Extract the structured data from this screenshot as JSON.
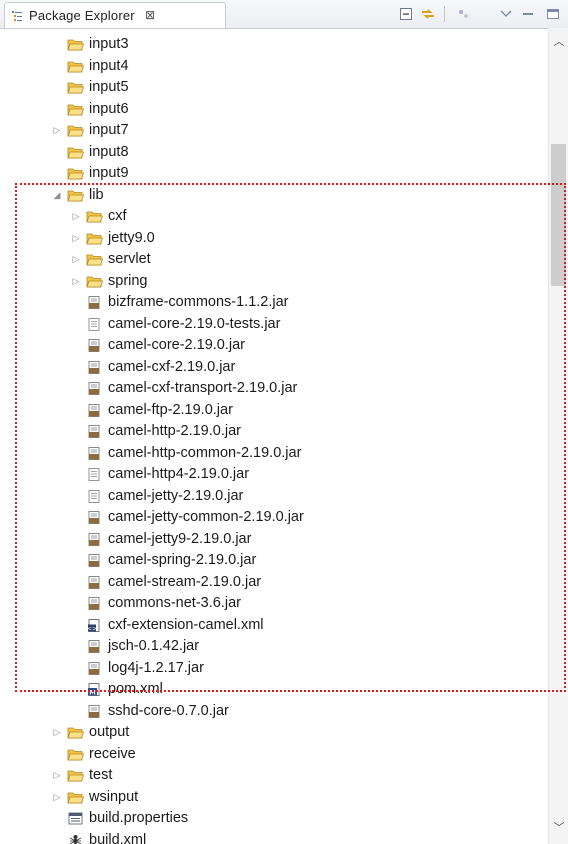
{
  "view": {
    "title": "Package Explorer",
    "close_glyph": "⊠"
  },
  "toolbar": [
    {
      "icon": "collapse-all-icon"
    },
    {
      "icon": "link-with-editor-icon"
    },
    {
      "icon": "filters-icon"
    },
    {
      "icon": "view-menu-icon"
    },
    {
      "icon": "minimize-icon"
    },
    {
      "icon": "maximize-icon"
    }
  ],
  "tree": {
    "items": [
      {
        "label": "input3",
        "icon": "folder-icon",
        "twisty": ""
      },
      {
        "label": "input4",
        "icon": "folder-icon",
        "twisty": ""
      },
      {
        "label": "input5",
        "icon": "folder-icon",
        "twisty": ""
      },
      {
        "label": "input6",
        "icon": "folder-icon",
        "twisty": ""
      },
      {
        "label": "input7",
        "icon": "folder-icon",
        "twisty": "collapsed"
      },
      {
        "label": "input8",
        "icon": "folder-icon",
        "twisty": ""
      },
      {
        "label": "input9",
        "icon": "folder-icon",
        "twisty": ""
      },
      {
        "label": "lib",
        "icon": "folder-icon",
        "twisty": "expanded"
      },
      {
        "label": "cxf",
        "icon": "folder-icon",
        "twisty": "collapsed"
      },
      {
        "label": "jetty9.0",
        "icon": "folder-icon",
        "twisty": "collapsed"
      },
      {
        "label": "servlet",
        "icon": "folder-icon",
        "twisty": "collapsed"
      },
      {
        "label": "spring",
        "icon": "folder-icon",
        "twisty": "collapsed"
      },
      {
        "label": "bizframe-commons-1.1.2.jar",
        "icon": "jar-icon",
        "twisty": ""
      },
      {
        "label": "camel-core-2.19.0-tests.jar",
        "icon": "file-icon",
        "twisty": ""
      },
      {
        "label": "camel-core-2.19.0.jar",
        "icon": "jar-icon",
        "twisty": ""
      },
      {
        "label": "camel-cxf-2.19.0.jar",
        "icon": "jar-icon",
        "twisty": ""
      },
      {
        "label": "camel-cxf-transport-2.19.0.jar",
        "icon": "jar-icon",
        "twisty": ""
      },
      {
        "label": "camel-ftp-2.19.0.jar",
        "icon": "jar-icon",
        "twisty": ""
      },
      {
        "label": "camel-http-2.19.0.jar",
        "icon": "jar-icon",
        "twisty": ""
      },
      {
        "label": "camel-http-common-2.19.0.jar",
        "icon": "jar-icon",
        "twisty": ""
      },
      {
        "label": "camel-http4-2.19.0.jar",
        "icon": "file-icon",
        "twisty": ""
      },
      {
        "label": "camel-jetty-2.19.0.jar",
        "icon": "file-icon",
        "twisty": ""
      },
      {
        "label": "camel-jetty-common-2.19.0.jar",
        "icon": "jar-icon",
        "twisty": ""
      },
      {
        "label": "camel-jetty9-2.19.0.jar",
        "icon": "jar-icon",
        "twisty": ""
      },
      {
        "label": "camel-spring-2.19.0.jar",
        "icon": "jar-icon",
        "twisty": ""
      },
      {
        "label": "camel-stream-2.19.0.jar",
        "icon": "jar-icon",
        "twisty": ""
      },
      {
        "label": "commons-net-3.6.jar",
        "icon": "jar-icon",
        "twisty": ""
      },
      {
        "label": "cxf-extension-camel.xml",
        "icon": "xml-icon",
        "twisty": ""
      },
      {
        "label": "jsch-0.1.42.jar",
        "icon": "jar-icon",
        "twisty": ""
      },
      {
        "label": "log4j-1.2.17.jar",
        "icon": "jar-icon",
        "twisty": ""
      },
      {
        "label": "pom.xml",
        "icon": "maven-pom-icon",
        "twisty": ""
      },
      {
        "label": "sshd-core-0.7.0.jar",
        "icon": "jar-icon",
        "twisty": ""
      },
      {
        "label": "output",
        "icon": "folder-icon",
        "twisty": "collapsed"
      },
      {
        "label": "receive",
        "icon": "folder-icon",
        "twisty": ""
      },
      {
        "label": "test",
        "icon": "folder-icon",
        "twisty": "collapsed"
      },
      {
        "label": "wsinput",
        "icon": "folder-icon",
        "twisty": "collapsed"
      },
      {
        "label": "build.properties",
        "icon": "properties-icon",
        "twisty": ""
      },
      {
        "label": "build.xml",
        "icon": "ant-build-icon",
        "twisty": ""
      }
    ]
  },
  "colors": {
    "annotation_box": "#e01a1a",
    "folder": "#f2c447",
    "jar": "#8d6b3f"
  }
}
